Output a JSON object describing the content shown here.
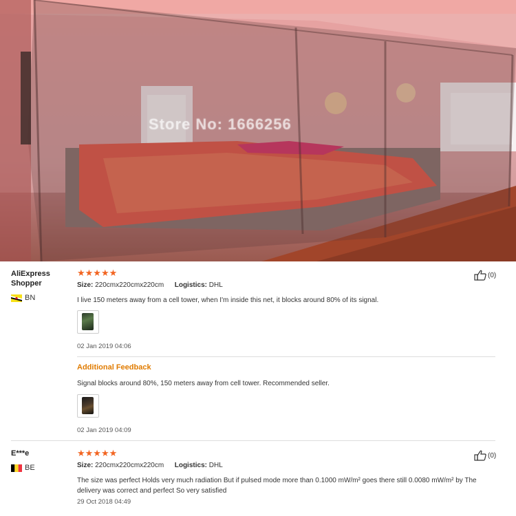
{
  "photo": {
    "watermark": "Store No: 1666256"
  },
  "reviews": [
    {
      "user": "AliExpress Shopper",
      "country": "BN",
      "stars": "★★★★★",
      "size_label": "Size:",
      "size_value": "220cmx220cmx220cm",
      "logistics_label": "Logistics:",
      "logistics_value": "DHL",
      "text": "I live 150 meters away from a cell tower, when I'm inside this net, it blocks around 80% of its signal.",
      "date": "02 Jan 2019 04:06",
      "likes": "(0)",
      "additional": {
        "heading": "Additional Feedback",
        "text": "Signal blocks around 80%, 150 meters away from cell tower. Recommended seller.",
        "date": "02 Jan 2019 04:09"
      }
    },
    {
      "user": "E***e",
      "country": "BE",
      "stars": "★★★★★",
      "size_label": "Size:",
      "size_value": "220cmx220cmx220cm",
      "logistics_label": "Logistics:",
      "logistics_value": "DHL",
      "text": "The size was perfect Holds very much radiation But if pulsed mode more than 0.1000 mW/m² goes there still 0.0080 mW/m² by The delivery was correct and perfect So very satisfied",
      "date": "29 Oct 2018 04:49",
      "likes": "(0)"
    }
  ],
  "colors": {
    "star": "#f26522",
    "additional_heading": "#e07b00"
  },
  "icons": [
    "thumbs-up-icon",
    "flag-bn-icon",
    "flag-be-icon",
    "review-photo-icon"
  ]
}
